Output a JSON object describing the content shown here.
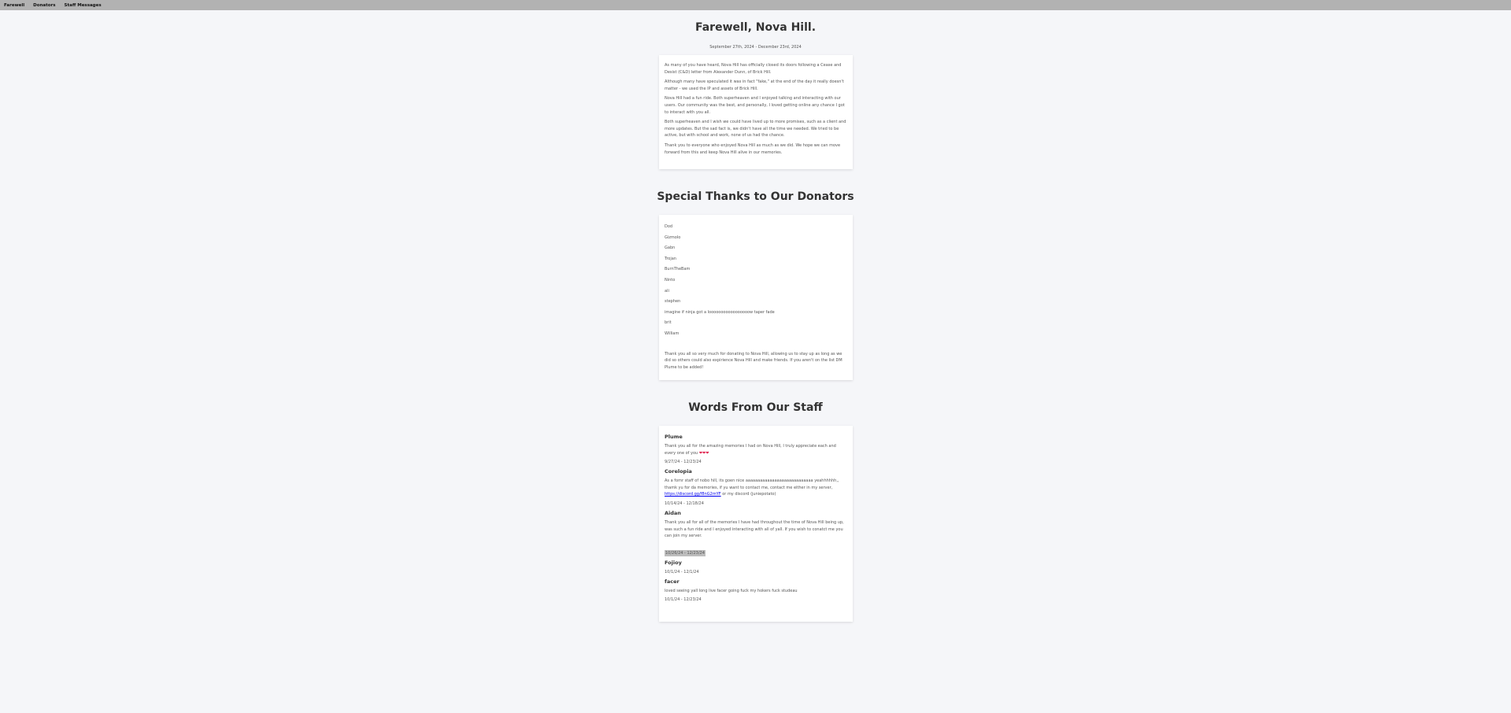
{
  "nav": {
    "farewell": "Farewell",
    "donators": "Donators",
    "staff": "Staff Messages"
  },
  "farewell": {
    "title": "Farewell, Nova Hill.",
    "dates": "September 27th, 2024 - December 23rd, 2024",
    "paragraphs": [
      "As many of you have heard, Nova Hill has officially closed its doors following a Cease and Desist (C&D) letter from Alexander Dunn, of Brick Hill.",
      "Although many have speculated it was in fact \"fake,\" at the end of the day it really doesn't matter - we used the IP and assets of Brick Hill.",
      "Nova Hill had a fun ride. Both superheaven and I enjoyed talking and interacting with our users. Our community was the best, and personally, I loved getting online any chance I got to interact with you all.",
      "Both superheaven and I wish we could have lived up to more promises, such as a client and more updates. But the sad fact is, we didn't have all the time we needed. We tried to be active, but with school and work, none of us had the chance.",
      "Thank you to everyone who enjoyed Nova Hill as much as we did. We hope we can move forward from this and keep Nova Hill alive in our memories."
    ]
  },
  "donators": {
    "title": "Special Thanks to Our Donators",
    "names": [
      "Dod",
      "Gizmolo",
      "Gabn",
      "Trojan",
      "BurnTheBam",
      "Ninto",
      "ali",
      "stephen",
      "imagine if ninja got a looooooooooooooooow taper fade",
      "brit",
      "William"
    ],
    "thanks": "Thank you all so very much for donating to Nova Hill, allowing us to stay up as long as we did so others could also expirience Nova Hill and make friends. If you aren't on the list DM Plume to be added!"
  },
  "staff": {
    "title": "Words From Our Staff",
    "members": [
      {
        "name": "Plume",
        "message": "Thank you all for the amazing memories I had on Nova Hill, I truly appreciate each and every one of you",
        "hearts": "❤❤❤",
        "dates": "9/27/24 - 12/23/24"
      },
      {
        "name": "Corelopia",
        "message": "As a fomr staff of nobo hill, its goen nice aaaaaaaaaaaaaaaaaaaaaaaaaaaa yeahhhhhh,, thamk yu for da memories, if yu want to contact me, contact me either in my server,",
        "link": "https://discord.gg/f8nG2mYF",
        "message_end": "or my discord (juniepotato)",
        "dates": "10/14/24 - 12/18/24"
      },
      {
        "name": "Aidan",
        "message": "Thank you all for all of the memories I have had throughout the time of Nova Hill being up, was such a fun ride and I enjoyed interacting with all of yall. If you wish to conatct me you can join my server.",
        "dates": "10/26/24 - 12/23/24"
      },
      {
        "name": "Fojioy",
        "message": "",
        "dates": "10/1/24 - 12/1/24"
      },
      {
        "name": "facer",
        "message": "loved seeing yall long live facer going fuck my hokers fuck studeau",
        "dates": "10/1/24 - 12/23/24"
      }
    ]
  },
  "colors": {
    "navbar": "#b2b2b2",
    "background": "#f5f6f9",
    "card": "#ffffff",
    "heart": "#e0234e",
    "link": "#0000ee"
  }
}
